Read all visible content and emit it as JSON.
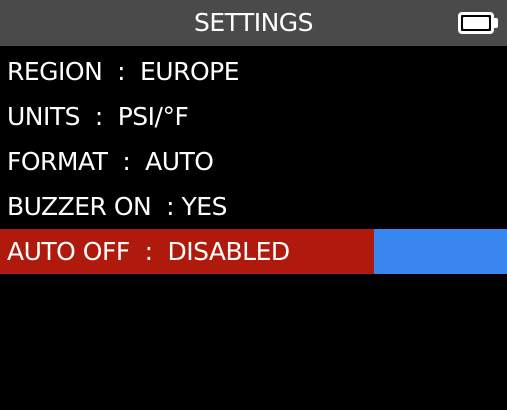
{
  "header": {
    "title": "SETTINGS",
    "battery_icon": "battery-full-icon"
  },
  "menu": {
    "items": [
      {
        "label": "REGION  :  EUROPE",
        "selected": false
      },
      {
        "label": "UNITS  :  PSI/°F",
        "selected": false
      },
      {
        "label": "FORMAT  :  AUTO",
        "selected": false
      },
      {
        "label": "BUZZER ON  : YES",
        "selected": false
      },
      {
        "label": "AUTO OFF  :  DISABLED",
        "selected": true
      }
    ]
  },
  "colors": {
    "background": "#000000",
    "header_background": "#4a4a4a",
    "text": "#ffffff",
    "selected_row": "#b01a0c",
    "value_highlight": "#3a86f0"
  }
}
